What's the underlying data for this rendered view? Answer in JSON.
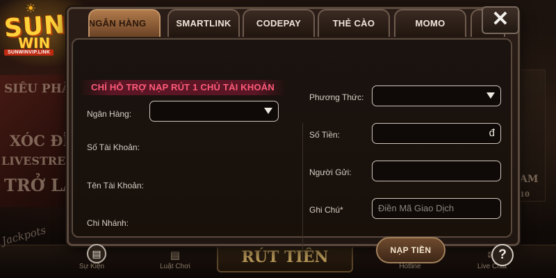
{
  "logo": {
    "line1": "SUN",
    "line2": "WIN",
    "site": "SUNWINVIP.LINK"
  },
  "background": {
    "banner_lines": [
      "SIÊU PHẨM",
      "XÓC ĐĨA",
      "LIVESTREAM",
      "TRỞ LẠI"
    ],
    "right_card_lines": [
      "AM",
      "10"
    ],
    "jackpot_text": "Jackpots",
    "withdraw_label": "RÚT TIỀN",
    "bottom_nav": [
      {
        "label": "Sự Kiện",
        "icon": "party-icon"
      },
      {
        "label": "Luật Chơi",
        "icon": "rules-icon"
      },
      {
        "label": "Hotline",
        "icon": "phone-icon"
      },
      {
        "label": "Live Chat",
        "icon": "chat-icon"
      }
    ]
  },
  "tabs": [
    {
      "label": "NGÂN HÀNG",
      "active": true
    },
    {
      "label": "SMARTLINK",
      "active": false
    },
    {
      "label": "CODEPAY",
      "active": false
    },
    {
      "label": "THẺ CÀO",
      "active": false
    },
    {
      "label": "MOMO",
      "active": false
    },
    {
      "label": "",
      "active": false
    }
  ],
  "close_label": "✕",
  "notice": "CHỈ HỖ TRỢ NẠP RÚT 1 CHỦ TÀI KHOẢN",
  "left_form": {
    "bank_label": "Ngân Hàng:",
    "bank_value": "",
    "account_number_label": "Số Tài Khoản:",
    "account_name_label": "Tên Tài Khoản:",
    "branch_label": "Chi Nhánh:"
  },
  "right_form": {
    "method_label": "Phương Thức:",
    "method_value": "",
    "amount_label": "Số Tiền:",
    "amount_value": "",
    "currency_symbol": "đ",
    "sender_label": "Người Gửi:",
    "sender_value": "",
    "note_label": "Ghi Chú*",
    "note_placeholder": "Điền Mã Giao Dịch"
  },
  "deposit_button": "NẠP TIỀN",
  "help_label": "?",
  "colors": {
    "notice_text": "#ff5a7a",
    "active_tab": "#b07a4a",
    "logo_gold": "#ffd23a"
  }
}
